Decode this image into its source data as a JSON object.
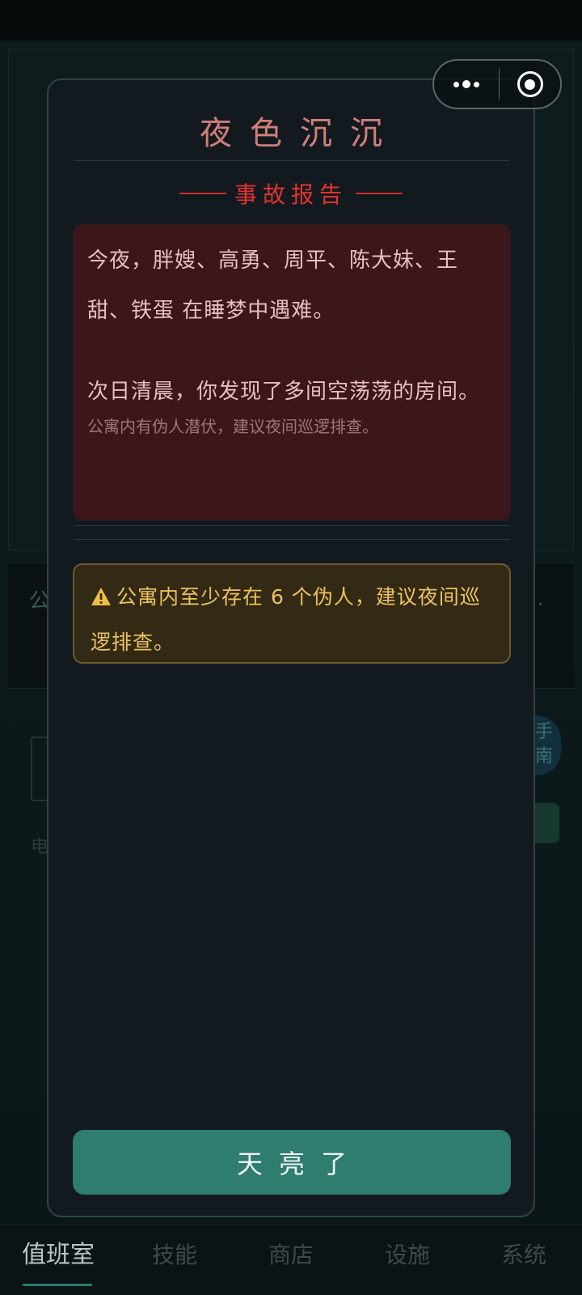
{
  "background": {
    "banner_text": "公",
    "banner_suffix": "·",
    "round_button_text": "手\n南",
    "side_char": "电"
  },
  "capsule": {
    "more_icon": "more-dots-icon",
    "close_icon": "target-close-icon"
  },
  "modal": {
    "title": "夜色沉沉",
    "section_title": "事故报告",
    "report": {
      "paragraph1": "今夜，胖嫂、高勇、周平、陈大妹、王甜、铁蛋 在睡梦中遇难。",
      "paragraph2": "次日清晨，你发现了多间空荡荡的房间。",
      "note": "公寓内有伪人潜伏，建议夜间巡逻排查。"
    },
    "warning": {
      "icon": "warning-triangle-icon",
      "text": "公寓内至少存在 6 个伪人，建议夜间巡逻排查。"
    },
    "confirm_button": "天亮了"
  },
  "tabs": [
    {
      "label": "值班室",
      "active": true
    },
    {
      "label": "技能",
      "active": false
    },
    {
      "label": "商店",
      "active": false
    },
    {
      "label": "设施",
      "active": false
    },
    {
      "label": "系统",
      "active": false
    }
  ],
  "colors": {
    "accent": "#2e7d6f",
    "danger": "#e2332d",
    "warning": "#edc15f",
    "title": "#d07f78"
  }
}
